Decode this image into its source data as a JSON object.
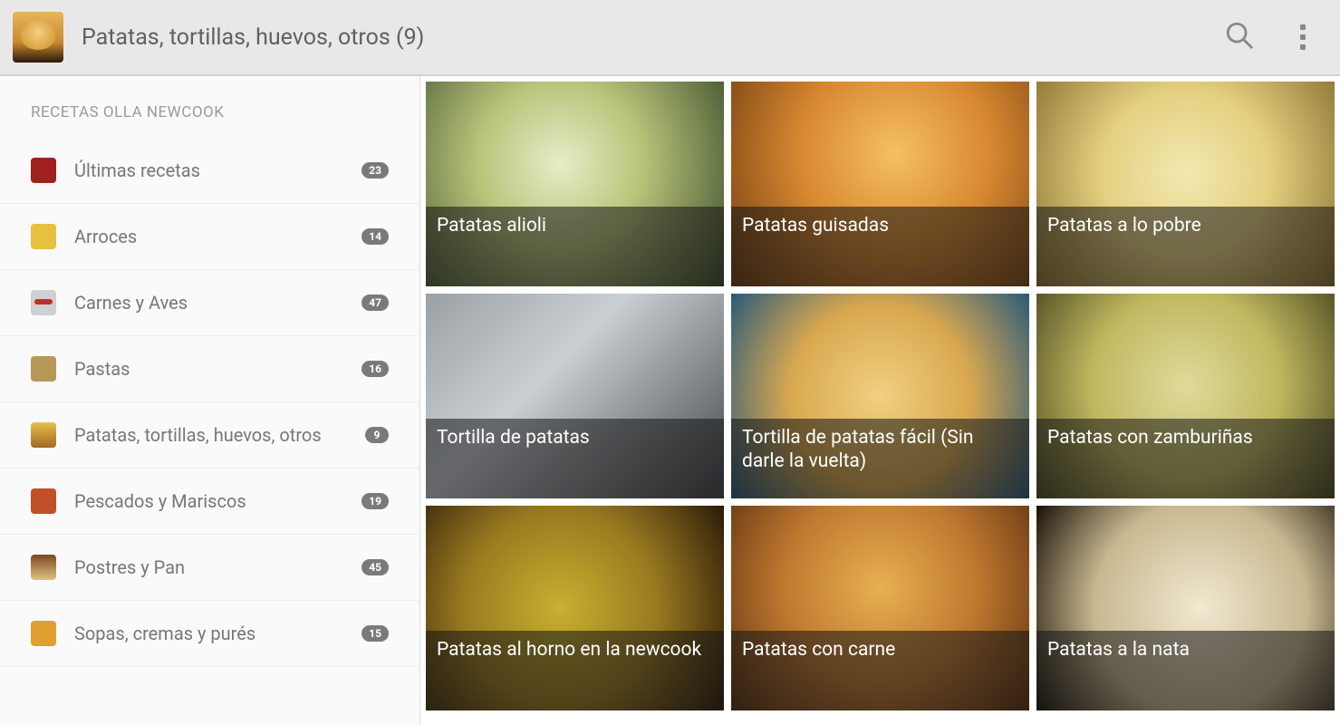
{
  "header": {
    "title": "Patatas, tortillas, huevos, otros (9)"
  },
  "sidebar": {
    "heading": "RECETAS OLLA NEWCOOK",
    "items": [
      {
        "label": "Últimas recetas",
        "count": "23"
      },
      {
        "label": "Arroces",
        "count": "14"
      },
      {
        "label": "Carnes y Aves",
        "count": "47"
      },
      {
        "label": "Pastas",
        "count": "16"
      },
      {
        "label": "Patatas, tortillas, huevos, otros",
        "count": "9"
      },
      {
        "label": "Pescados y Mariscos",
        "count": "19"
      },
      {
        "label": "Postres y Pan",
        "count": "45"
      },
      {
        "label": "Sopas, cremas y purés",
        "count": "15"
      }
    ]
  },
  "recipes": [
    {
      "title": "Patatas alioli"
    },
    {
      "title": "Patatas guisadas"
    },
    {
      "title": "Patatas a lo pobre"
    },
    {
      "title": "Tortilla de patatas"
    },
    {
      "title": "Tortilla de patatas fácil (Sin darle la vuelta)"
    },
    {
      "title": "Patatas con zamburiñas"
    },
    {
      "title": "Patatas al horno en la newcook"
    },
    {
      "title": "Patatas con carne"
    },
    {
      "title": "Patatas a la nata"
    }
  ]
}
